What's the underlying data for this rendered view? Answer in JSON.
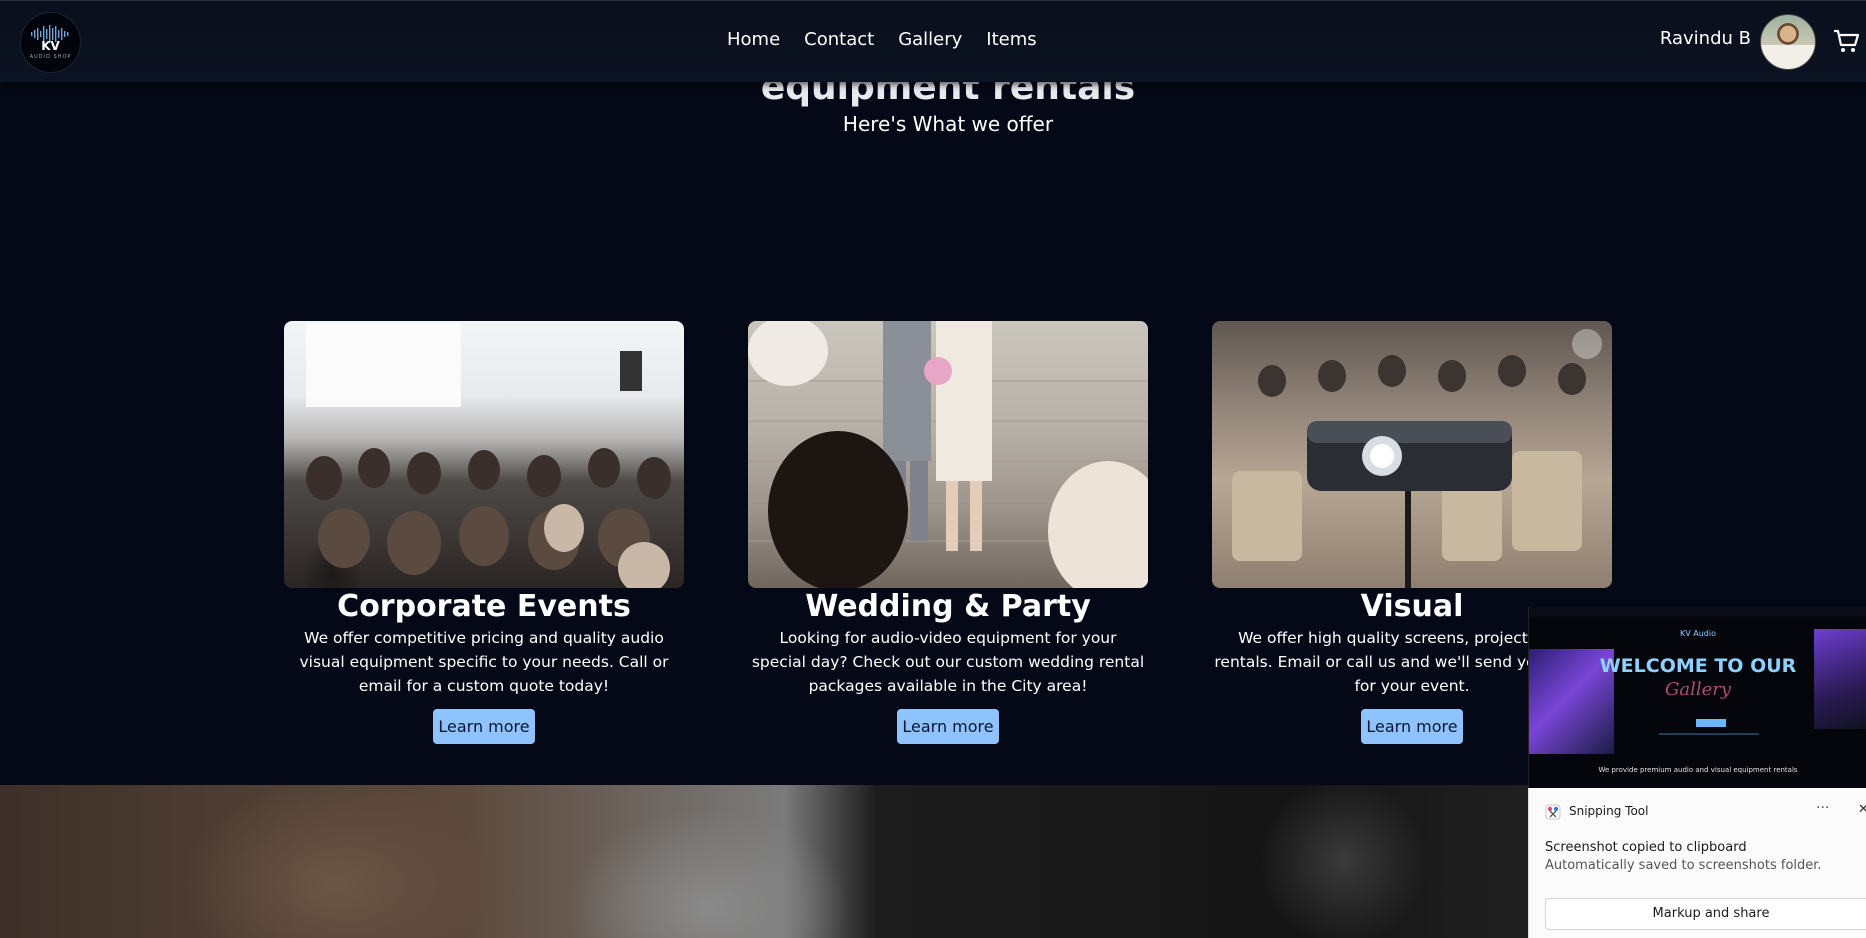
{
  "logo": {
    "mark": "KV",
    "subtitle": "AUDIO SHOP"
  },
  "nav": {
    "items": [
      "Home",
      "Contact",
      "Gallery",
      "Items"
    ]
  },
  "user": {
    "name": "Ravindu B"
  },
  "hero": {
    "title": "equipment rentals",
    "subtitle": "Here's What we offer"
  },
  "cards": [
    {
      "title": "Corporate Events",
      "description": "We offer competitive pricing and quality audio visual equipment specific to your needs. Call or email for a custom quote today!",
      "button": "Learn more"
    },
    {
      "title": "Wedding & Party",
      "description": "Looking for audio-video equipment for your special day? Check out our custom wedding rental packages available in the City area!",
      "button": "Learn more"
    },
    {
      "title": "Visual",
      "description": "We offer high quality screens, projectors and rentals. Email or call us and we'll send you a quote for your event.",
      "button": "Learn more"
    }
  ],
  "snip_preview": {
    "brand": "KV Audio",
    "welcome": "WELCOME TO OUR",
    "gallery": "Gallery",
    "caption": "We provide premium audio and visual equipment rentals"
  },
  "toast": {
    "app_name": "Snipping Tool",
    "more": "···",
    "close": "✕",
    "title": "Screenshot copied to clipboard",
    "body": "Automatically saved to screenshots folder.",
    "action": "Markup and share"
  },
  "colors": {
    "background": "#050816",
    "button": "#8ec3ff",
    "nav": "#0c1322"
  },
  "icons": [
    "cart-icon",
    "logo-waveform-icon"
  ]
}
